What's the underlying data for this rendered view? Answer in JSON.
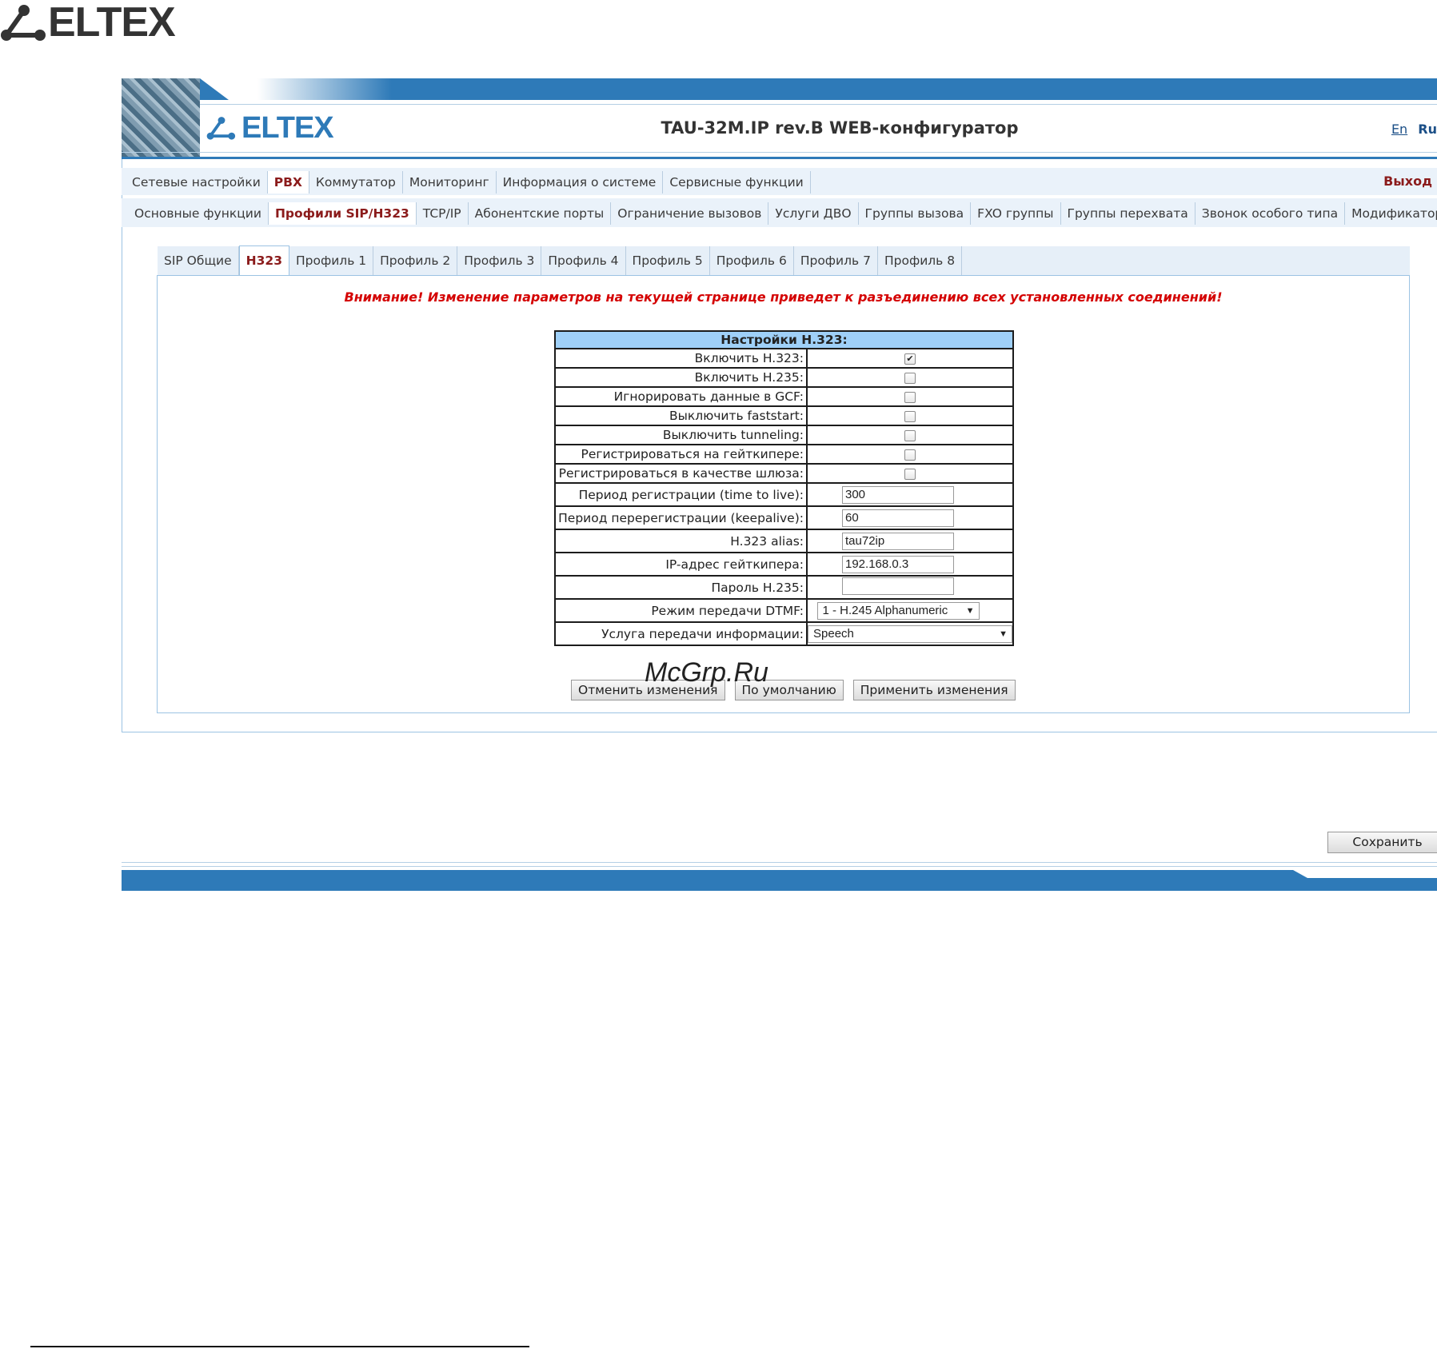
{
  "logo_text": "ELTEX",
  "header": {
    "logo_text": "ELTEX",
    "title": "TAU-32M.IP rev.B WEB-конфигуратор",
    "lang_en": "En",
    "lang_ru": "Ru"
  },
  "main_nav": {
    "items": [
      "Сетевые настройки",
      "PBX",
      "Коммутатор",
      "Мониторинг",
      "Информация о системе",
      "Сервисные функции"
    ],
    "active": "PBX",
    "logout": "Выход"
  },
  "sub_nav": {
    "items": [
      "Основные функции",
      "Профили SIP/H323",
      "TCP/IP",
      "Абонентские порты",
      "Ограничение вызовов",
      "Услуги ДВО",
      "Группы вызова",
      "FXO группы",
      "Группы перехвата",
      "Звонок особого типа",
      "Модификаторы"
    ],
    "active": "Профили SIP/H323"
  },
  "tabs": {
    "items": [
      "SIP Общие",
      "H323",
      "Профиль 1",
      "Профиль 2",
      "Профиль 3",
      "Профиль 4",
      "Профиль 5",
      "Профиль 6",
      "Профиль 7",
      "Профиль 8"
    ],
    "active": "H323"
  },
  "warning": "Внимание! Изменение параметров на текущей странице приведет к разъединению всех установленных соединений!",
  "settings": {
    "title": "Настройки H.323:",
    "enable_h323": {
      "label": "Включить H.323:",
      "checked": true
    },
    "enable_h235": {
      "label": "Включить H.235:",
      "checked": false
    },
    "ignore_gcf": {
      "label": "Игнорировать данные в GCF:",
      "checked": false
    },
    "disable_faststart": {
      "label": "Выключить faststart:",
      "checked": false
    },
    "disable_tunneling": {
      "label": "Выключить tunneling:",
      "checked": false
    },
    "register_gatekeeper": {
      "label": "Регистрироваться на гейткипере:",
      "checked": false
    },
    "register_gateway": {
      "label": "Регистрироваться в качестве шлюза:",
      "checked": false
    },
    "ttl": {
      "label": "Период регистрации (time to live):",
      "value": "300"
    },
    "keepalive": {
      "label": "Период перерегистрации (keepalive):",
      "value": "60"
    },
    "alias": {
      "label": "H.323 alias:",
      "value": "tau72ip"
    },
    "gk_ip": {
      "label": "IP-адрес гейткипера:",
      "value": "192.168.0.3"
    },
    "h235_password": {
      "label": "Пароль H.235:",
      "value": ""
    },
    "dtmf_mode": {
      "label": "Режим передачи DTMF:",
      "value": "1 - H.245 Alphanumeric"
    },
    "info_service": {
      "label": "Услуга передачи информации:",
      "value": "Speech"
    }
  },
  "buttons": {
    "cancel": "Отменить изменения",
    "default": "По умолчанию",
    "apply": "Применить изменения",
    "save": "Сохранить"
  },
  "watermark": "McGrp.Ru",
  "colors": {
    "accent": "#2e7ab8",
    "active_tab": "#8b1b1b",
    "warning": "#d40000",
    "table_header": "#9fd0f8"
  }
}
